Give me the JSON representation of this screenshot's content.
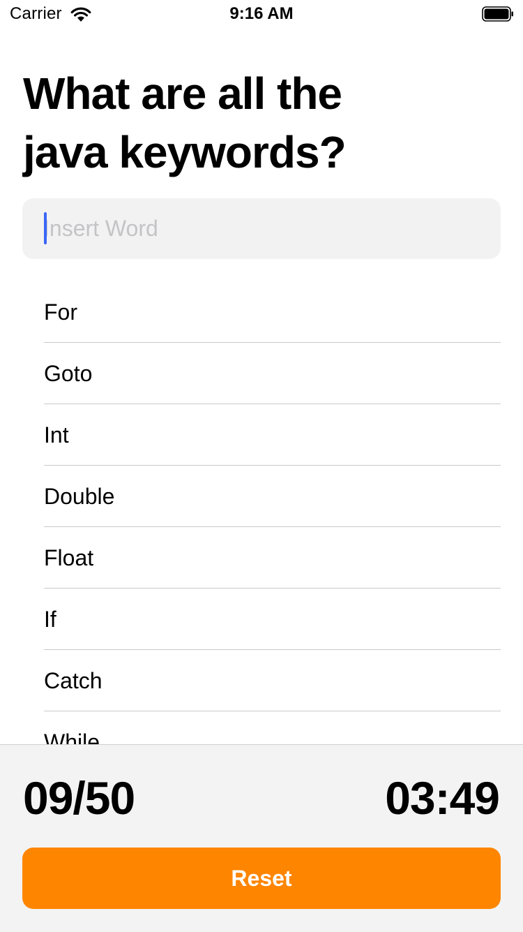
{
  "status_bar": {
    "carrier": "Carrier",
    "time": "9:16 AM",
    "icons": [
      "wifi-icon",
      "battery-icon"
    ]
  },
  "title": "What are all the java keywords?",
  "input": {
    "value": "",
    "placeholder": "Insert Word"
  },
  "answers": [
    "For",
    "Goto",
    "Int",
    "Double",
    "Float",
    "If",
    "Catch",
    "While"
  ],
  "footer": {
    "score": "09/50",
    "timer": "03:49",
    "reset_label": "Reset"
  },
  "colors": {
    "accent": "#fe8500",
    "caret": "#3b66f5",
    "input_background": "#f2f2f3",
    "footer_background": "#f3f3f3"
  }
}
